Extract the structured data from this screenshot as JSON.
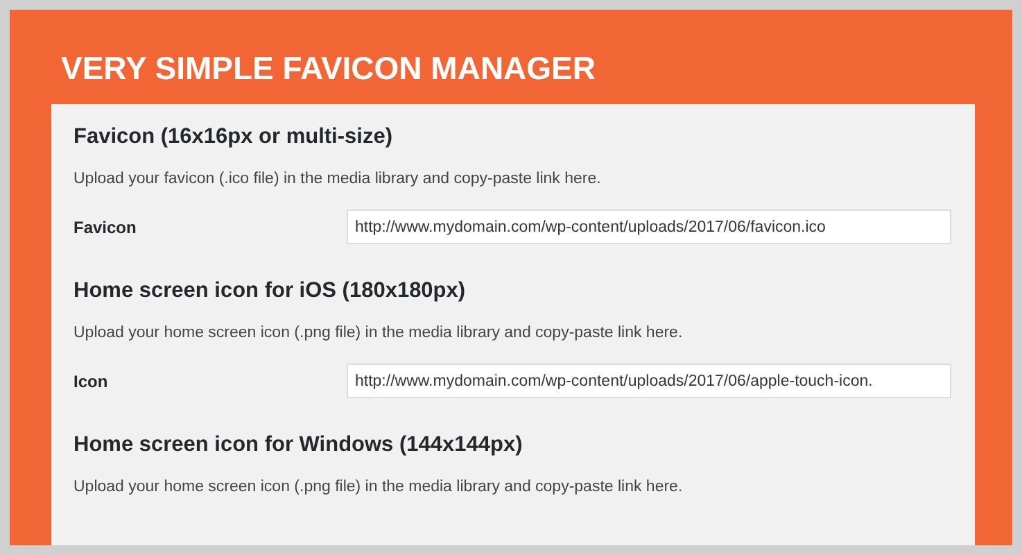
{
  "title": "VERY SIMPLE FAVICON MANAGER",
  "sections": [
    {
      "heading": "Favicon (16x16px or multi-size)",
      "description": "Upload your favicon (.ico file) in the media library and copy-paste link here.",
      "field": {
        "label": "Favicon",
        "value": "http://www.mydomain.com/wp-content/uploads/2017/06/favicon.ico"
      }
    },
    {
      "heading": "Home screen icon for iOS (180x180px)",
      "description": "Upload your home screen icon (.png file) in the media library and copy-paste link here.",
      "field": {
        "label": "Icon",
        "value": "http://www.mydomain.com/wp-content/uploads/2017/06/apple-touch-icon."
      }
    },
    {
      "heading": "Home screen icon for Windows (144x144px)",
      "description": "Upload your home screen icon (.png file) in the media library and copy-paste link here."
    }
  ]
}
